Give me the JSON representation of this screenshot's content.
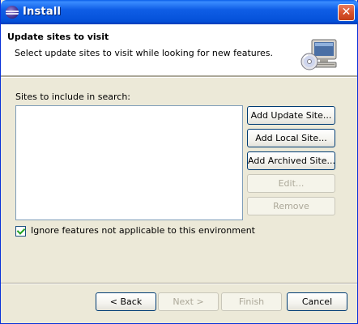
{
  "window": {
    "title": "Install",
    "close_label": "✕"
  },
  "header": {
    "title": "Update sites to visit",
    "description": "Select update sites to visit while looking for new features."
  },
  "sites": {
    "label": "Sites to include in search:",
    "items": []
  },
  "side_buttons": {
    "add_update_site": "Add Update Site...",
    "add_local_site": "Add Local Site...",
    "add_archived_site": "Add Archived Site...",
    "edit": "Edit...",
    "remove": "Remove"
  },
  "filter": {
    "label": "Ignore features not applicable to this environment",
    "checked": true
  },
  "footer": {
    "back": "< Back",
    "next": "Next >",
    "finish": "Finish",
    "cancel": "Cancel"
  },
  "colors": {
    "titlebar": "#0450d8",
    "dialog_bg": "#ece9d8",
    "close_button": "#d9532d"
  }
}
